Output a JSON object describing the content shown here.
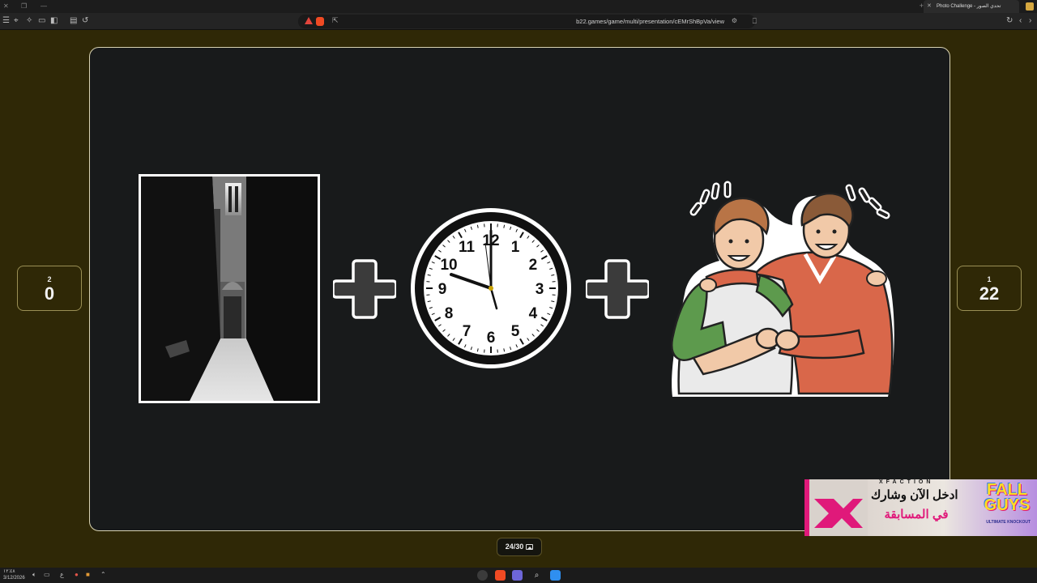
{
  "browser": {
    "tab_title": "Photo Challenge - تحدي الصور",
    "address": "b22.games/game/multi/presentation/cEMrShBpVa/view"
  },
  "players": [
    {
      "rank": "2",
      "score": "0"
    },
    {
      "rank": "1",
      "score": "22"
    }
  ],
  "puzzle": {
    "tiles": [
      "dark-alley-photo",
      "clock-illustration",
      "two-friends-illustration"
    ],
    "clock_numbers": [
      "12",
      "1",
      "2",
      "3",
      "4",
      "5",
      "6",
      "7",
      "8",
      "9",
      "10",
      "11"
    ]
  },
  "progress": {
    "counter": "24/30"
  },
  "ad": {
    "brand": "XFACTION",
    "line1": "ادخل الآن وشارك",
    "line2": "في المسابقة",
    "game_logo": "FALL GUYS",
    "game_sub": "ULTIMATE KNOCKOUT"
  },
  "taskbar": {
    "time": "١٢:٤٨",
    "date": "3/12/2026"
  },
  "colors": {
    "page_bg": "#2f2806",
    "stage_bg": "#181a1b",
    "stage_border": "#d9d3b2",
    "accent_pink": "#e0197a"
  }
}
